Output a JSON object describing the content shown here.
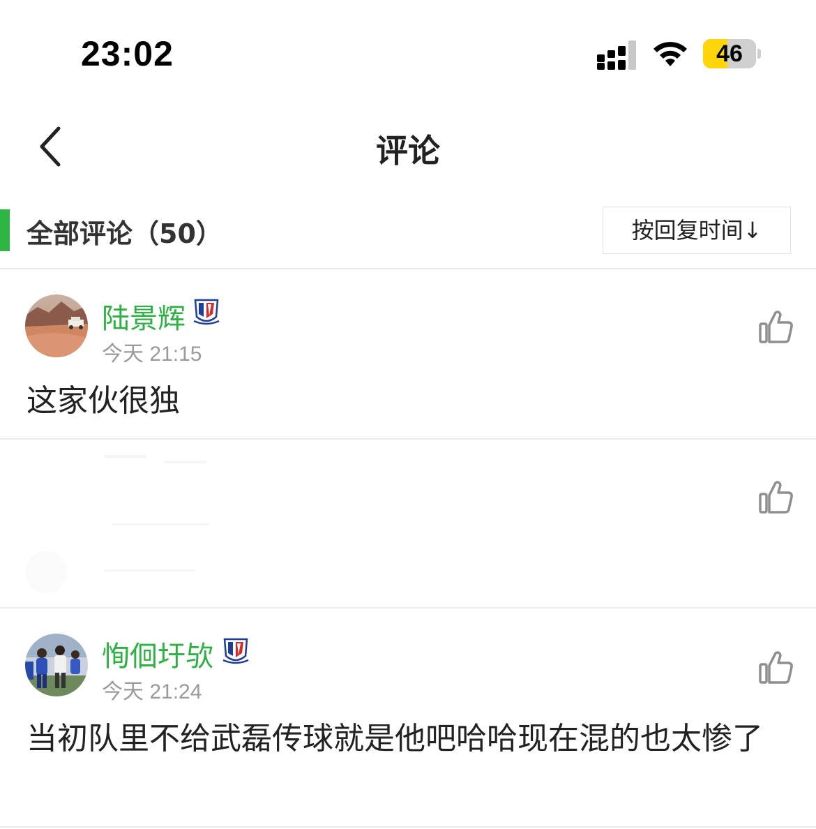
{
  "status_bar": {
    "time": "23:02",
    "battery": "46",
    "battery_level": 0.46,
    "icons": [
      "signal-icon",
      "wifi-icon",
      "battery-icon"
    ]
  },
  "nav": {
    "title": "评论",
    "back_icon": "chevron-left-icon"
  },
  "section": {
    "title": "全部评论（50）",
    "sort_label": "按回复时间↓",
    "accent_color": "#2fb544"
  },
  "comments": [
    {
      "username": "陆景辉",
      "time": "今天 21:15",
      "text": "这家伙很独",
      "avatar": "desert-jeep-avatar",
      "badge": "shenhua-badge-icon"
    },
    {
      "username": "",
      "time": "",
      "text": "",
      "avatar": "faded-avatar",
      "badge": ""
    },
    {
      "username": "恂佪圩欤",
      "time": "今天 21:24",
      "text": "当初队里不给武磊传球就是他吧哈哈现在混的也太惨了",
      "avatar": "football-players-avatar",
      "badge": "shenhua-badge-icon"
    }
  ],
  "colors": {
    "username_green": "#2eb043",
    "timestamp_gray": "#9a9a9a",
    "divider": "#ececec"
  }
}
